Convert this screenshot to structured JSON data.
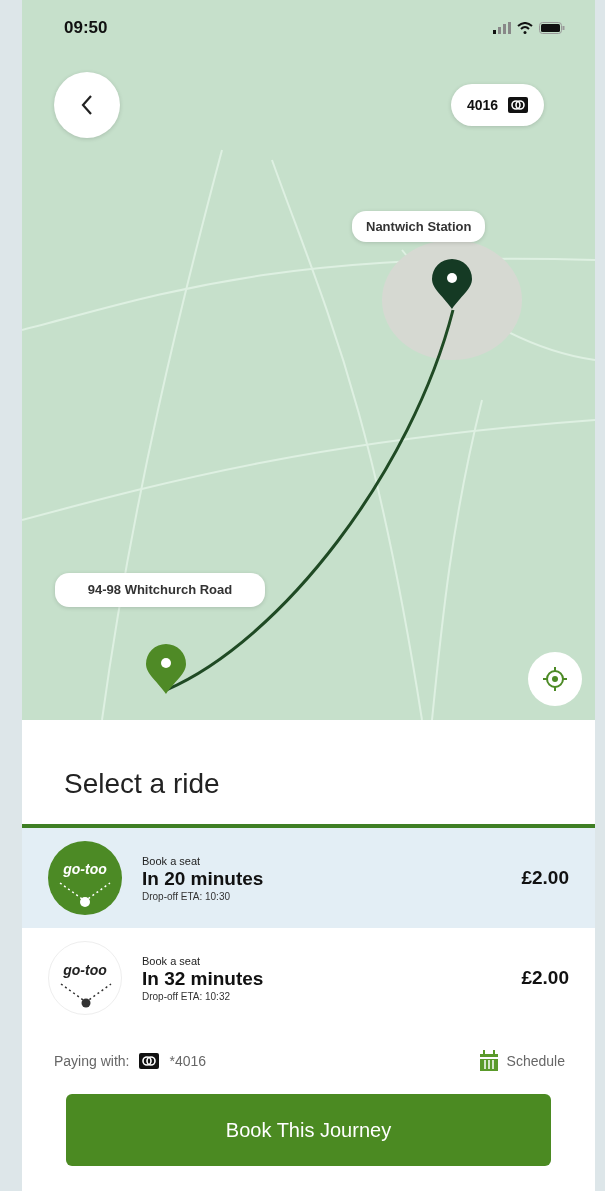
{
  "status_bar": {
    "time": "09:50"
  },
  "map": {
    "card_pill": {
      "label": "4016"
    },
    "destination": {
      "label": "Nantwich Station"
    },
    "origin": {
      "label": "94-98 Whitchurch Road"
    }
  },
  "sheet": {
    "title": "Select a ride",
    "rides": [
      {
        "logo": "go-too",
        "caption": "Book a seat",
        "time": "In 20 minutes",
        "eta": "Drop-off ETA: 10:30",
        "price": "£2.00",
        "selected": true
      },
      {
        "logo": "go-too",
        "caption": "Book a seat",
        "time": "In 32 minutes",
        "eta": "Drop-off ETA: 10:32",
        "price": "£2.00",
        "selected": false
      }
    ],
    "payment": {
      "label": "Paying with:",
      "card": "*4016"
    },
    "schedule": {
      "label": "Schedule"
    },
    "book_button": {
      "label": "Book This Journey"
    }
  }
}
